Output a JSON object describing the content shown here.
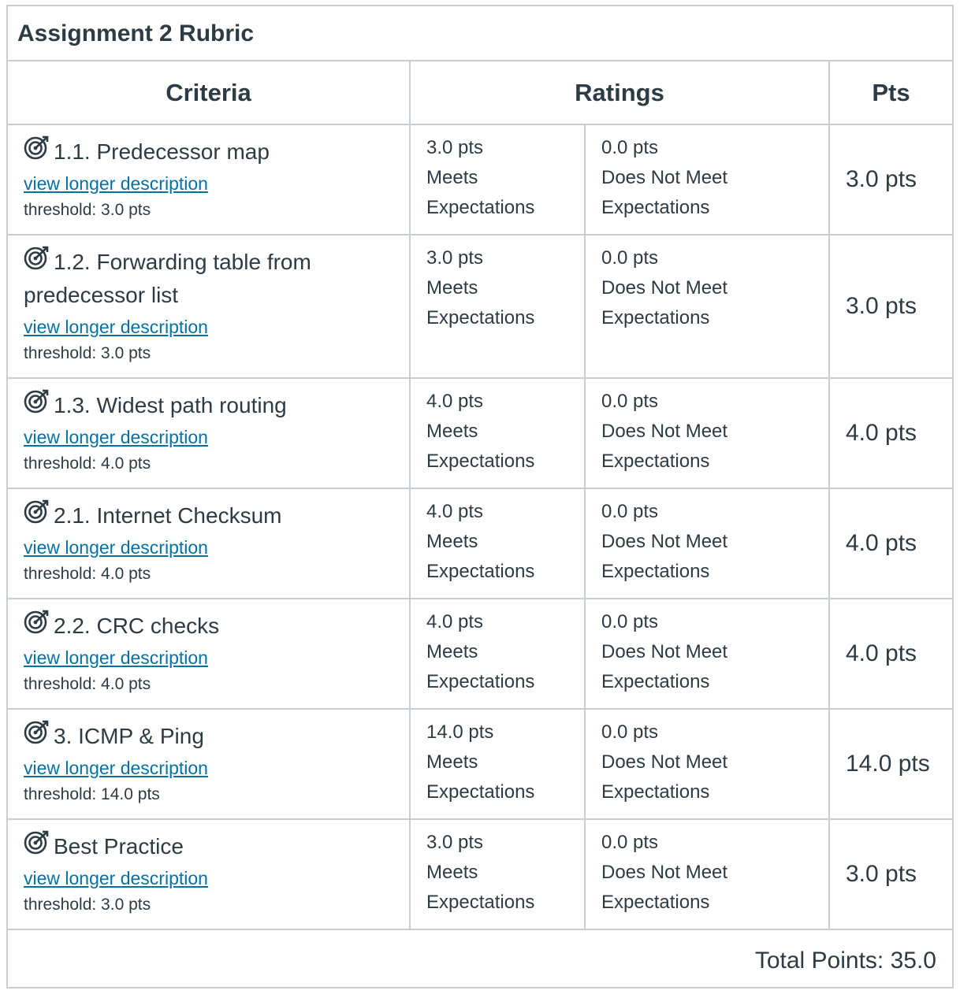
{
  "rubric": {
    "title": "Assignment 2 Rubric",
    "headers": {
      "criteria": "Criteria",
      "ratings": "Ratings",
      "pts": "Pts"
    },
    "view_link_label": "view longer description",
    "rows": [
      {
        "name": "1.1. Predecessor map",
        "threshold": "threshold: 3.0 pts",
        "r1_pts": "3.0 pts",
        "r1_label": "Meets Expectations",
        "r2_pts": "0.0 pts",
        "r2_label": "Does Not Meet Expectations",
        "pts": "3.0 pts"
      },
      {
        "name": "1.2. Forwarding table from predecessor list",
        "threshold": "threshold: 3.0 pts",
        "r1_pts": "3.0 pts",
        "r1_label": "Meets Expectations",
        "r2_pts": "0.0 pts",
        "r2_label": "Does Not Meet Expectations",
        "pts": "3.0 pts"
      },
      {
        "name": "1.3. Widest path routing",
        "threshold": "threshold: 4.0 pts",
        "r1_pts": "4.0 pts",
        "r1_label": "Meets Expectations",
        "r2_pts": "0.0 pts",
        "r2_label": "Does Not Meet Expectations",
        "pts": "4.0 pts"
      },
      {
        "name": "2.1. Internet Checksum",
        "threshold": "threshold: 4.0 pts",
        "r1_pts": "4.0 pts",
        "r1_label": "Meets Expectations",
        "r2_pts": "0.0 pts",
        "r2_label": "Does Not Meet Expectations",
        "pts": "4.0 pts"
      },
      {
        "name": "2.2. CRC checks",
        "threshold": "threshold: 4.0 pts",
        "r1_pts": "4.0 pts",
        "r1_label": "Meets Expectations",
        "r2_pts": "0.0 pts",
        "r2_label": "Does Not Meet Expectations",
        "pts": "4.0 pts"
      },
      {
        "name": "3. ICMP & Ping",
        "threshold": "threshold: 14.0 pts",
        "r1_pts": "14.0 pts",
        "r1_label": "Meets Expectations",
        "r2_pts": "0.0 pts",
        "r2_label": "Does Not Meet Expectations",
        "pts": "14.0 pts"
      },
      {
        "name": "Best Practice",
        "threshold": "threshold: 3.0 pts",
        "r1_pts": "3.0 pts",
        "r1_label": "Meets Expectations",
        "r2_pts": "0.0 pts",
        "r2_label": "Does Not Meet Expectations",
        "pts": "3.0 pts"
      }
    ],
    "total": "Total Points: 35.0",
    "icon": "outcome-target-icon",
    "link_color": "#0770a3",
    "text_color": "#2d3b45",
    "border_color": "#c7cdd1"
  }
}
